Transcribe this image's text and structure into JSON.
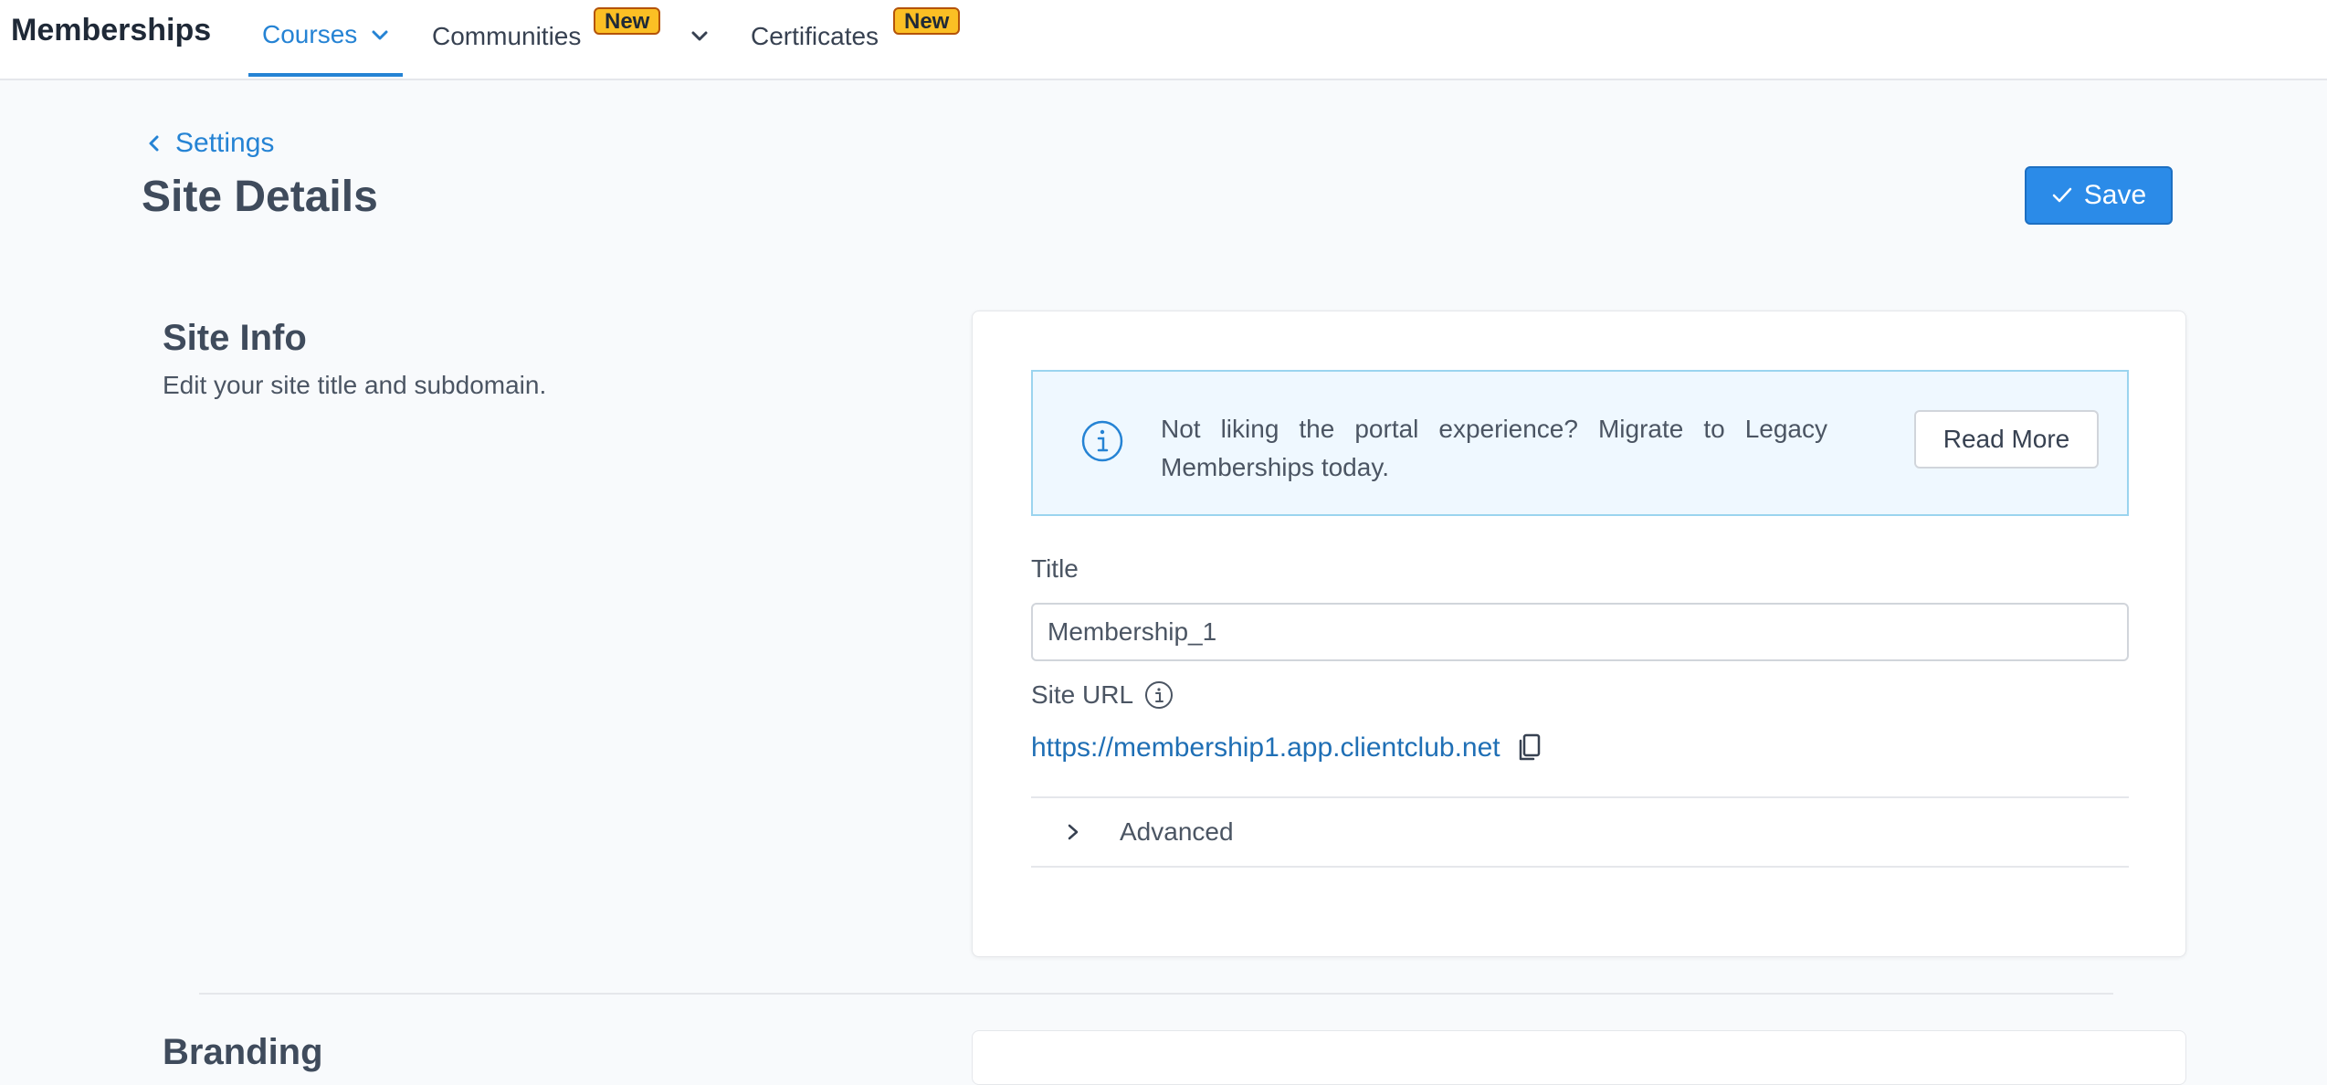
{
  "nav": {
    "brand": "Memberships",
    "items": [
      {
        "label": "Courses"
      },
      {
        "label": "Communities",
        "badge": "New"
      },
      {
        "label": "Certificates",
        "badge": "New"
      }
    ]
  },
  "header": {
    "breadcrumb": "Settings",
    "title": "Site Details",
    "save_label": "Save"
  },
  "site_info": {
    "title": "Site Info",
    "description": "Edit your site title and subdomain.",
    "alert": {
      "text": "Not liking the portal experience? Migrate to Legacy Memberships today.",
      "button_label": "Read More"
    },
    "title_label": "Title",
    "title_value": "Membership_1",
    "site_url_label": "Site URL",
    "site_url": "https://membership1.app.clientclub.net",
    "advanced_label": "Advanced"
  },
  "next_section": {
    "title": "Branding"
  },
  "colors": {
    "accent": "#2583d4",
    "save_button": "#2b8be8",
    "badge": "#fbbf24",
    "alert_bg": "#eff8ff"
  }
}
